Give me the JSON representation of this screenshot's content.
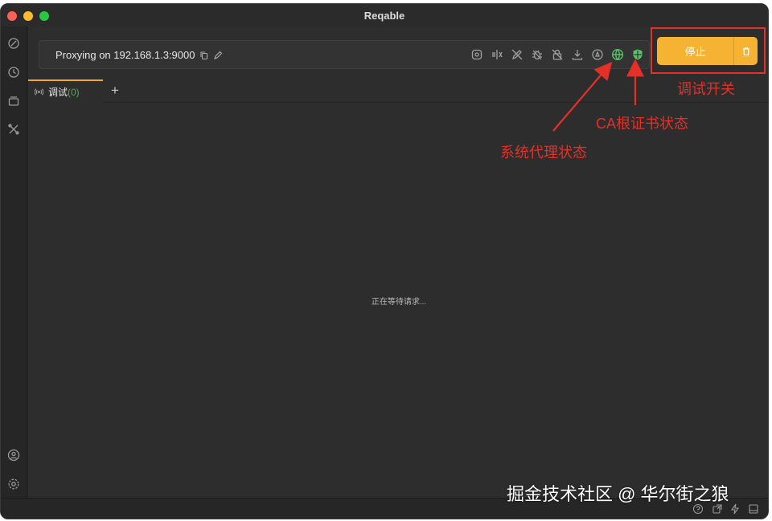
{
  "window": {
    "title": "Reqable"
  },
  "proxy": {
    "status_text": "Proxying on 192.168.1.3:9000"
  },
  "toolbar": {
    "tools": [
      "at-sign-icon",
      "split-icon",
      "no-pen-icon",
      "bug-icon",
      "no-lock-icon",
      "download-icon",
      "capture-icon",
      "globe-icon",
      "shield-icon"
    ],
    "system_proxy_color": "#58c46a",
    "ca_cert_color": "#58c46a"
  },
  "actions": {
    "stop_label": "停止"
  },
  "tabs": [
    {
      "label": "调试",
      "count": "(0)"
    }
  ],
  "main": {
    "empty_text": "正在等待请求..."
  },
  "annotations": {
    "debug_switch": "调试开关",
    "ca_cert_status": "CA根证书状态",
    "system_proxy_status": "系统代理状态"
  },
  "watermark": "掘金技术社区 @ 华尔街之狼",
  "colors": {
    "accent": "#f5b233",
    "annotation": "#e53027",
    "success": "#4caf50"
  }
}
